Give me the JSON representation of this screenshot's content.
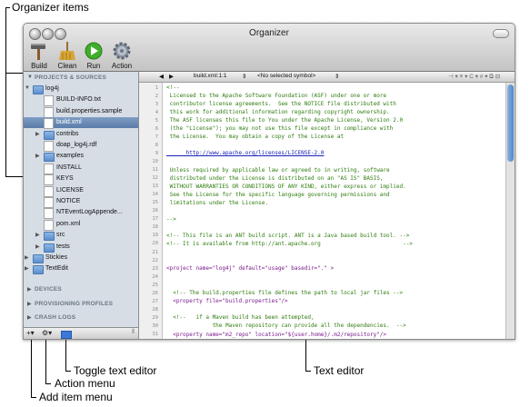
{
  "callouts": {
    "organizer_items": "Organizer items",
    "toggle_text_editor": "Toggle text editor",
    "action_menu": "Action menu",
    "add_item_menu": "Add item menu",
    "text_editor": "Text editor"
  },
  "window": {
    "title": "Organizer"
  },
  "toolbar": [
    {
      "label": "Build",
      "icon": "hammer-icon"
    },
    {
      "label": "Clean",
      "icon": "broom-icon"
    },
    {
      "label": "Run",
      "icon": "run-icon"
    },
    {
      "label": "Action",
      "icon": "gear-icon"
    }
  ],
  "sidebar": {
    "section_projects": "PROJECTS & SOURCES",
    "items": [
      {
        "label": "log4j",
        "kind": "folder",
        "expanded": true
      },
      {
        "label": "BUILD-INFO.txt",
        "kind": "file"
      },
      {
        "label": "build.properties.sample",
        "kind": "file"
      },
      {
        "label": "build.xml",
        "kind": "file",
        "selected": true
      },
      {
        "label": "contribs",
        "kind": "folder"
      },
      {
        "label": "doap_log4j.rdf",
        "kind": "file"
      },
      {
        "label": "examples",
        "kind": "folder"
      },
      {
        "label": "INSTALL",
        "kind": "file"
      },
      {
        "label": "KEYS",
        "kind": "file"
      },
      {
        "label": "LICENSE",
        "kind": "file"
      },
      {
        "label": "NOTICE",
        "kind": "file"
      },
      {
        "label": "NTEventLogAppende...",
        "kind": "file"
      },
      {
        "label": "pom.xml",
        "kind": "file"
      },
      {
        "label": "src",
        "kind": "folder"
      },
      {
        "label": "tests",
        "kind": "folder"
      },
      {
        "label": "Stickies",
        "kind": "folder"
      },
      {
        "label": "TextEdit",
        "kind": "folder"
      }
    ],
    "section_devices": "DEVICES",
    "section_profiles": "PROVISIONING PROFILES",
    "section_crash": "CRASH LOGS"
  },
  "navbar": {
    "file": "build.xml:1:1",
    "symbol": "<No selected symbol>"
  },
  "editor": {
    "lines": [
      {
        "n": "1",
        "cls": "cmt",
        "text": "<!--"
      },
      {
        "n": "2",
        "cls": "cmt",
        "text": " Licensed to the Apache Software Foundation (ASF) under one or more"
      },
      {
        "n": "3",
        "cls": "cmt",
        "text": " contributor license agreements.  See the NOTICE file distributed with"
      },
      {
        "n": "4",
        "cls": "cmt",
        "text": " this work for additional information regarding copyright ownership."
      },
      {
        "n": "5",
        "cls": "cmt",
        "text": " The ASF licenses this file to You under the Apache License, Version 2.0"
      },
      {
        "n": "6",
        "cls": "cmt",
        "text": " (the \"License\"); you may not use this file except in compliance with"
      },
      {
        "n": "7",
        "cls": "cmt",
        "text": " the License.  You may obtain a copy of the License at"
      },
      {
        "n": "8",
        "cls": "cmt",
        "text": ""
      },
      {
        "n": "9",
        "cls": "url",
        "text": "      http://www.apache.org/licenses/LICENSE-2.0"
      },
      {
        "n": "10",
        "cls": "cmt",
        "text": ""
      },
      {
        "n": "11",
        "cls": "cmt",
        "text": " Unless required by applicable law or agreed to in writing, software"
      },
      {
        "n": "12",
        "cls": "cmt",
        "text": " distributed under the License is distributed on an \"AS IS\" BASIS,"
      },
      {
        "n": "13",
        "cls": "cmt",
        "text": " WITHOUT WARRANTIES OR CONDITIONS OF ANY KIND, either express or implied."
      },
      {
        "n": "14",
        "cls": "cmt",
        "text": " See the License for the specific language governing permissions and"
      },
      {
        "n": "15",
        "cls": "cmt",
        "text": " limitations under the License."
      },
      {
        "n": "16",
        "cls": "cmt",
        "text": ""
      },
      {
        "n": "17",
        "cls": "cmt",
        "text": "-->"
      },
      {
        "n": "18",
        "cls": "cmt",
        "text": ""
      },
      {
        "n": "19",
        "cls": "cmt",
        "text": "<!-- This file is an ANT build script. ANT is a Java based build tool. -->"
      },
      {
        "n": "20",
        "cls": "cmt",
        "text": "<!-- It is available from http://ant.apache.org                         -->"
      },
      {
        "n": "21",
        "cls": "cmt",
        "text": ""
      },
      {
        "n": "22",
        "cls": "cmt",
        "text": ""
      },
      {
        "n": "23",
        "cls": "tag",
        "text": "<project name=\"log4j\" default=\"usage\" basedir=\".\" >"
      },
      {
        "n": "24",
        "cls": "cmt",
        "text": ""
      },
      {
        "n": "25",
        "cls": "cmt",
        "text": ""
      },
      {
        "n": "26",
        "cls": "cmt",
        "text": "  <!-- The build.properties file defines the path to local jar files -->"
      },
      {
        "n": "27",
        "cls": "tag",
        "text": "  <property file=\"build.properties\"/>"
      },
      {
        "n": "28",
        "cls": "cmt",
        "text": ""
      },
      {
        "n": "29",
        "cls": "cmt",
        "text": "  <!--   if a Maven build has been attempted,"
      },
      {
        "n": "30",
        "cls": "cmt",
        "text": "              the Maven repository can provide all the dependencies.  -->"
      },
      {
        "n": "31",
        "cls": "tag",
        "text": "  <property name=\"m2_repo\" location=\"${user.home}/.m2/repository\"/>"
      }
    ]
  }
}
